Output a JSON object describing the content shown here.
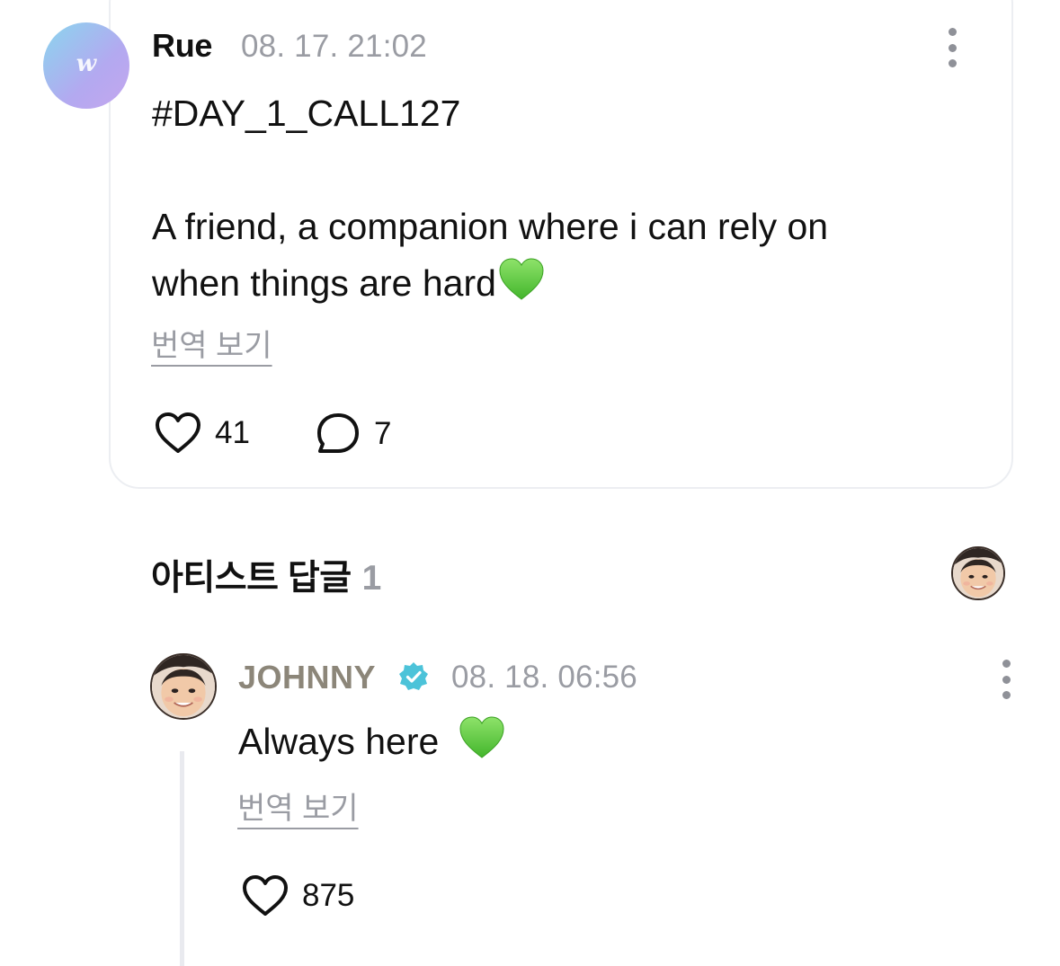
{
  "post": {
    "author": "Rue",
    "timestamp": "08. 17. 21:02",
    "avatar_letter": "w",
    "lines": [
      "#DAY_1_CALL127",
      "A friend, a companion where i can rely on",
      "when things are hard"
    ],
    "trailing_emoji": "green-heart",
    "translate_label": "번역 보기",
    "likes": "41",
    "comments": "7"
  },
  "artist_replies": {
    "title": "아티스트 답글",
    "count": "1"
  },
  "reply": {
    "author": "JOHNNY",
    "verified": true,
    "timestamp": "08. 18. 06:56",
    "text": "Always here ",
    "trailing_emoji": "green-heart",
    "translate_label": "번역 보기",
    "likes": "875"
  },
  "colors": {
    "muted": "#9a9ca3",
    "artist_name": "#8c8679",
    "verified_badge": "#4cc3d9",
    "green_heart": "#6dd24a",
    "card_border": "#eceef2"
  },
  "icons": [
    "kebab-menu-icon",
    "heart-outline-icon",
    "comment-bubble-icon",
    "verified-badge-icon",
    "green-heart-emoji"
  ]
}
